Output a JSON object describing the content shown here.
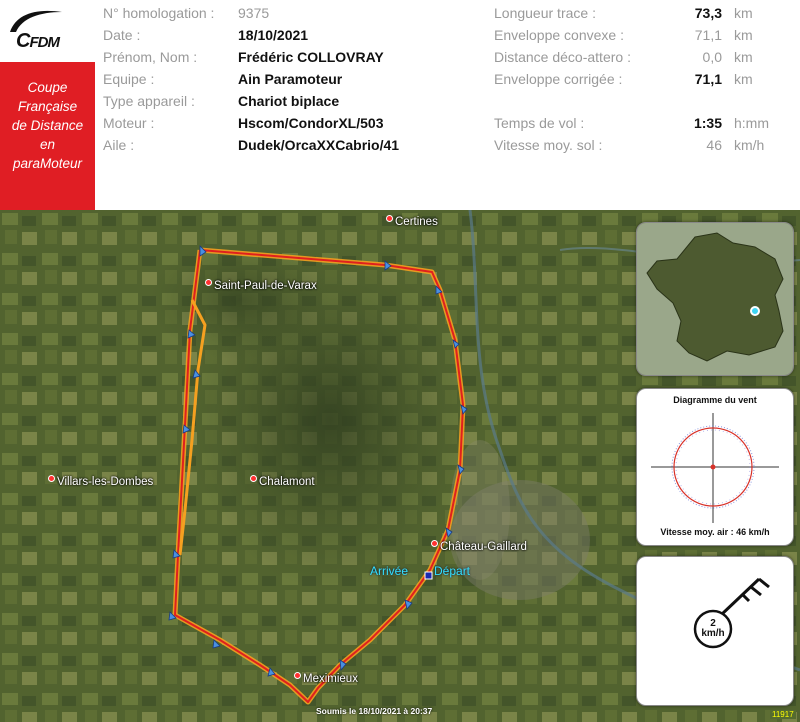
{
  "logo": {
    "text_c": "C",
    "text_fdm": "FDM"
  },
  "banner": {
    "lines": [
      "Coupe",
      "Française",
      "de Distance",
      "en",
      "paraMoteur"
    ]
  },
  "pilot_info": [
    {
      "label": "N° homologation :",
      "value": "9375",
      "bold": false
    },
    {
      "label": "Date :",
      "value": "18/10/2021",
      "bold": true
    },
    {
      "label": "Prénom, Nom :",
      "value": "Frédéric COLLOVRAY",
      "bold": true
    },
    {
      "label": "Equipe :",
      "value": "Ain Paramoteur",
      "bold": true
    },
    {
      "label": "Type appareil :",
      "value": "Chariot biplace",
      "bold": true
    },
    {
      "label": "Moteur :",
      "value": "Hscom/CondorXL/503",
      "bold": true
    },
    {
      "label": "Aile :",
      "value": "Dudek/OrcaXXCabrio/41",
      "bold": true
    }
  ],
  "flight_stats": [
    {
      "label": "Longueur trace :",
      "value": "73,3",
      "unit": "km",
      "bold": true,
      "row": 0
    },
    {
      "label": "Enveloppe convexe :",
      "value": "71,1",
      "unit": "km",
      "bold": false,
      "row": 1
    },
    {
      "label": "Distance déco-attero :",
      "value": "0,0",
      "unit": "km",
      "bold": false,
      "row": 2
    },
    {
      "label": "Enveloppe corrigée :",
      "value": "71,1",
      "unit": "km",
      "bold": true,
      "row": 3
    },
    {
      "label": "Temps de vol :",
      "value": "1:35",
      "unit": "h:mm",
      "bold": true,
      "row": 5
    },
    {
      "label": "Vitesse moy. sol :",
      "value": "46",
      "unit": "km/h",
      "bold": false,
      "row": 6
    }
  ],
  "map": {
    "towns": [
      {
        "name": "Certines",
        "key": "certines"
      },
      {
        "name": "Saint-Paul-de-Varax",
        "key": "saint-paul"
      },
      {
        "name": "Villars-les-Dombes",
        "key": "villars"
      },
      {
        "name": "Chalamont",
        "key": "chalamont"
      },
      {
        "name": "Château-Gaillard",
        "key": "chateau"
      },
      {
        "name": "Meximieux",
        "key": "meximieux"
      }
    ],
    "arrival_label": "Arrivée",
    "departure_label": "Départ",
    "submitted": "Soumis le 18/10/2021 à 20:37",
    "id": "11917",
    "track_color": "#e0201e",
    "track_alt_color": "#f5a020"
  },
  "wind_panel": {
    "title": "Diagramme du vent",
    "footer": "Vitesse moy. air : 46 km/h"
  },
  "wind_speed_panel": {
    "value": "2",
    "unit": "km/h"
  }
}
